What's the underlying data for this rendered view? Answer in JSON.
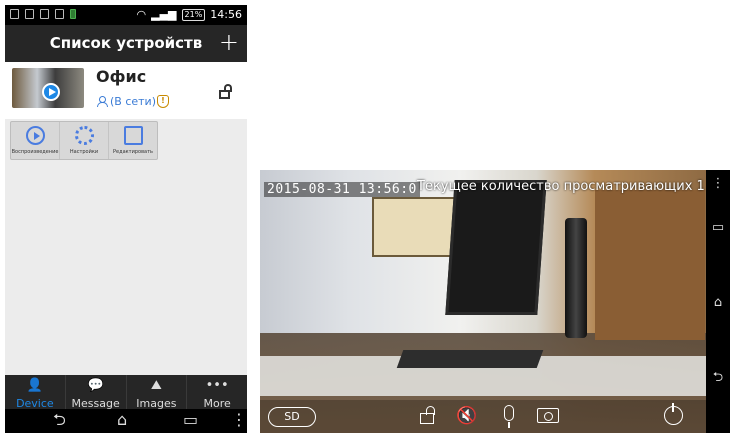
{
  "status_bar": {
    "battery": "21%",
    "time": "14:56"
  },
  "header": {
    "title": "Список устройств",
    "add_label": "+"
  },
  "device": {
    "name": "Офис",
    "status": "(В сети)",
    "shield_glyph": "!"
  },
  "device_actions": [
    {
      "label": "Воспроизведение",
      "icon": "play-icon"
    },
    {
      "label": "Настройки",
      "icon": "gear-icon"
    },
    {
      "label": "Редактировать",
      "icon": "edit-icon"
    }
  ],
  "tabs": [
    {
      "label": "Device",
      "icon": "person-icon",
      "glyph": "👤"
    },
    {
      "label": "Message",
      "icon": "message-icon",
      "glyph": "💬"
    },
    {
      "label": "Images",
      "icon": "image-icon",
      "glyph": "⛰"
    },
    {
      "label": "More",
      "icon": "more-icon",
      "glyph": "•••"
    }
  ],
  "nav": {
    "back": "⮌",
    "home": "⌂",
    "recents": "▭",
    "menu": "⋮"
  },
  "player": {
    "timestamp": "2015-08-31  13:56:0",
    "viewers": "Текущее количество просматривающих 1",
    "sd_label": "SD",
    "mute_glyph": "🔇",
    "side_menu": "⋮",
    "side_recents": "▭",
    "side_home": "⌂",
    "side_back": "⮌"
  },
  "colors": {
    "accent": "#1e88e5",
    "header_bg": "#262626",
    "online": "#3a7bd5"
  }
}
